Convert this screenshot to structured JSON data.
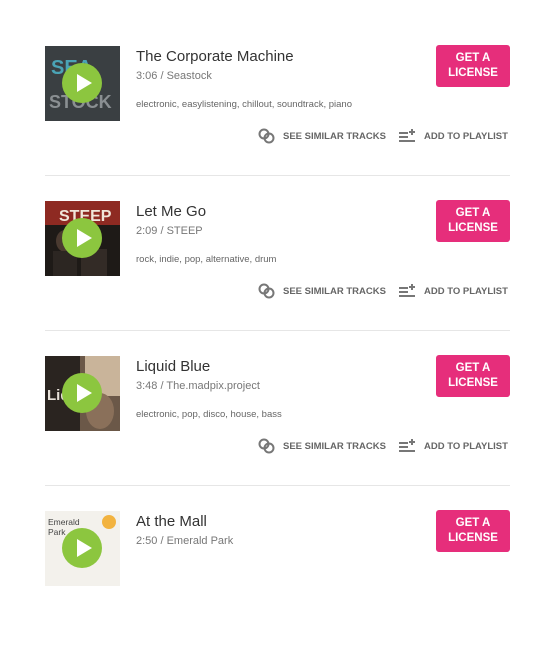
{
  "tracks": [
    {
      "title": "The Corporate Machine",
      "meta": "3:06 / Seastock",
      "tags": "electronic, easylistening, chillout, soundtrack, piano",
      "license_line1": "GET A",
      "license_line2": "LICENSE",
      "similar_label": "SEE SIMILAR TRACKS",
      "playlist_label": "ADD TO PLAYLIST",
      "thumb_text": [
        "SEA",
        "STOCK"
      ]
    },
    {
      "title": "Let Me Go",
      "meta": "2:09 / STEEP",
      "tags": "rock, indie, pop, alternative, drum",
      "license_line1": "GET A",
      "license_line2": "LICENSE",
      "similar_label": "SEE SIMILAR TRACKS",
      "playlist_label": "ADD TO PLAYLIST",
      "thumb_text": [
        "STEEP"
      ]
    },
    {
      "title": "Liquid Blue",
      "meta": "3:48 / The.madpix.project",
      "tags": "electronic, pop, disco, house, bass",
      "license_line1": "GET A",
      "license_line2": "LICENSE",
      "similar_label": "SEE SIMILAR TRACKS",
      "playlist_label": "ADD TO PLAYLIST",
      "thumb_text": [
        "Liq"
      ]
    },
    {
      "title": "At the Mall",
      "meta": "2:50 / Emerald Park",
      "license_line1": "GET A",
      "license_line2": "LICENSE",
      "thumb_text": [
        "Emerald",
        "Park"
      ]
    }
  ],
  "colors": {
    "license_bg": "#e62e7b",
    "play_bg": "#8cc63f",
    "divider": "#e6e6e6"
  },
  "icons": {
    "play": "play-icon",
    "similar": "link-rings-icon",
    "playlist": "add-to-list-icon"
  }
}
